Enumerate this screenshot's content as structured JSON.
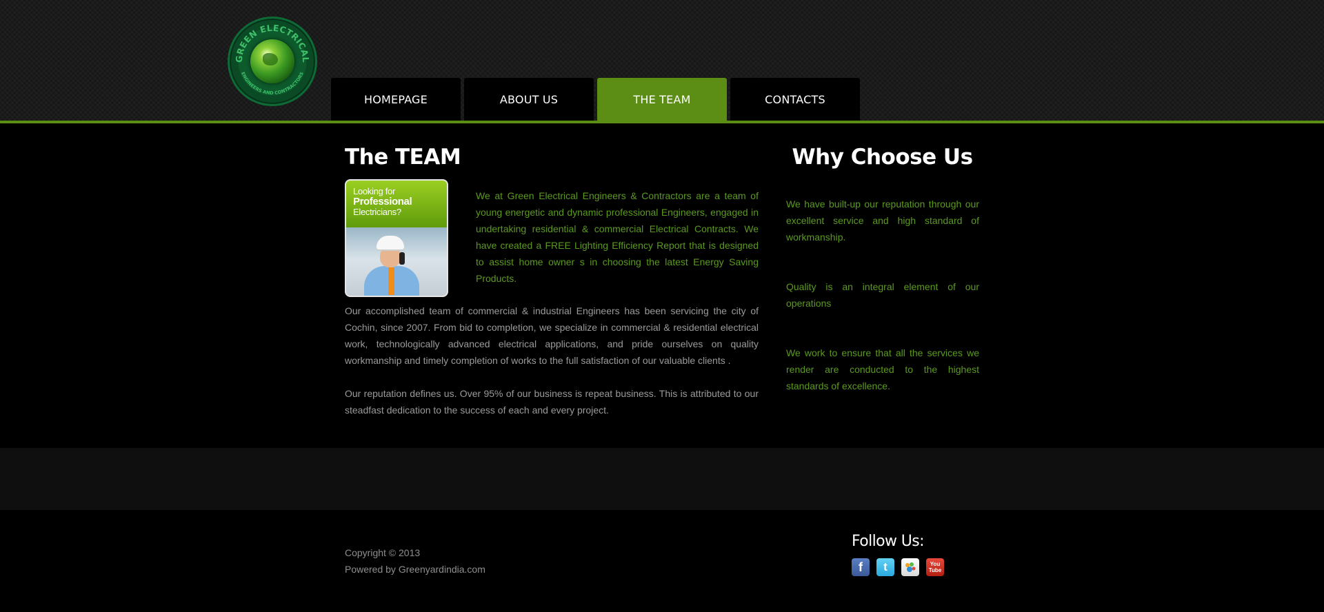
{
  "header": {
    "logo_label": "GREEN ELECTRICAL",
    "logo_sub": "ENGINEERS AND CONTRACTORS",
    "nav": [
      {
        "label": "HOMEPAGE"
      },
      {
        "label": "ABOUT US"
      },
      {
        "label": "THE TEAM"
      },
      {
        "label": "CONTACTS"
      }
    ],
    "active_nav": "THE TEAM"
  },
  "team": {
    "title": "The TEAM",
    "promo": {
      "line1": "Looking for",
      "line2": "Professional",
      "line3": "Electricians?"
    },
    "intro": "We at Green Electrical Engineers & Contractors are a team of young energetic and dynamic professional Engineers, engaged in undertaking residential & commercial Electrical Contracts. We have created a FREE Lighting Efficiency Report that is designed to assist home owner s in choosing the latest Energy Saving Products.",
    "body": "Our accomplished team of commercial & industrial Engineers has been servicing the city of Cochin, since 2007. From bid to completion, we specialize in commercial & residential electrical work, technologically advanced electrical applications, and pride ourselves on quality workmanship and timely completion of works to the full satisfaction of our valuable clients .",
    "reputation": "Our reputation defines us. Over 95% of our business is repeat business. This is attributed to our steadfast dedication to the success of each and every project."
  },
  "why": {
    "title": "Why Choose Us",
    "points": [
      "We have built-up our reputation through our excellent service and high standard of workmanship.",
      "Quality is an integral element of our operations",
      "We work to ensure that all the services we render are conducted to the highest standards of excellence."
    ]
  },
  "footer": {
    "copyright": "Copyright © 2013",
    "powered": "Powered by Greenyardindia.com",
    "follow_title": "Follow Us:",
    "social": [
      {
        "name": "facebook",
        "glyph": "f"
      },
      {
        "name": "twitter",
        "glyph": "t"
      },
      {
        "name": "myspace",
        "glyph": ""
      },
      {
        "name": "youtube",
        "glyph_top": "You",
        "glyph_bottom": "Tube"
      }
    ]
  },
  "colors": {
    "accent_green": "#5c8d14",
    "text_green": "#5c9a1e",
    "text_gray": "#9a9a9a"
  }
}
